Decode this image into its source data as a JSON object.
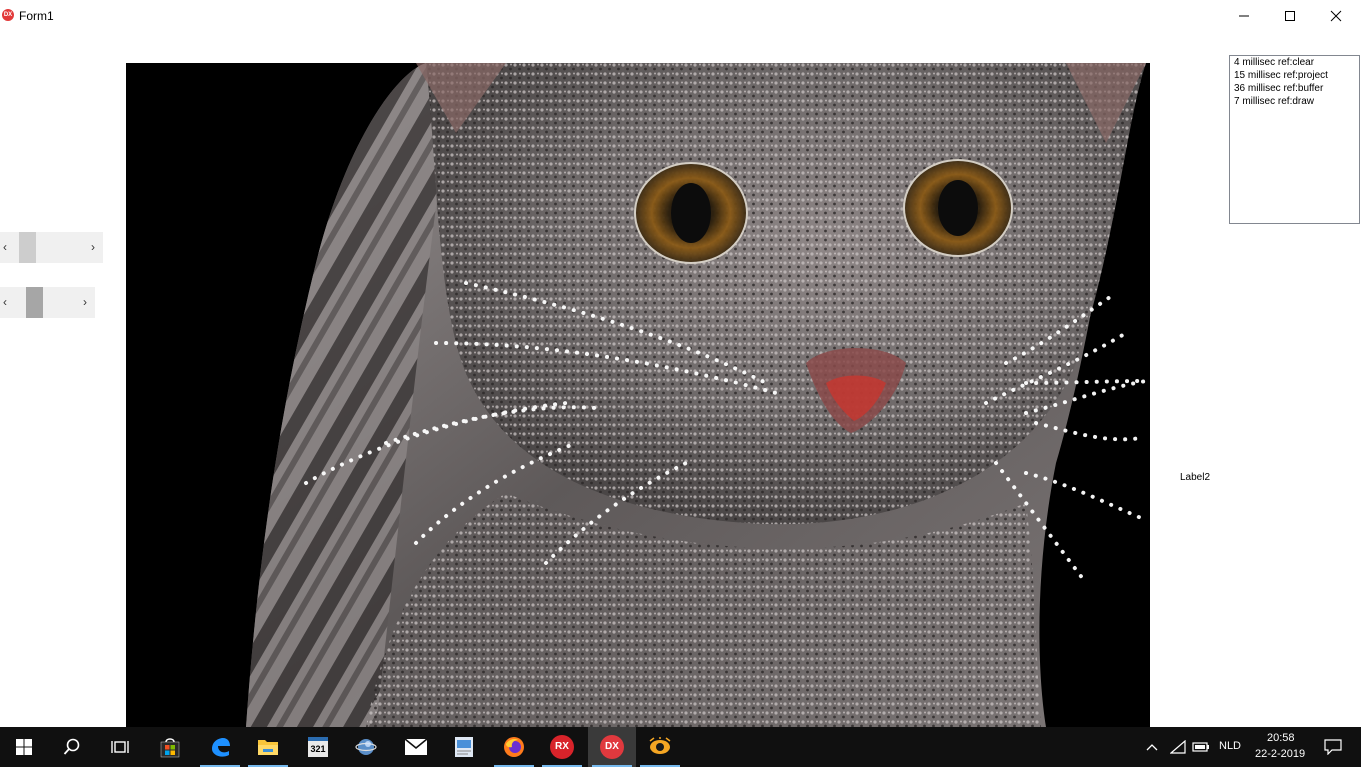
{
  "window": {
    "title": "Form1",
    "app_icon_text": "DX"
  },
  "memo": {
    "lines": [
      "4 millisec ref:clear",
      "15 millisec ref:project",
      "36 millisec ref:buffer",
      "7 millisec ref:draw"
    ]
  },
  "label2": "Label2",
  "scrollbars": [
    {
      "left_arrow": "‹",
      "right_arrow": "›",
      "position": 0.1
    },
    {
      "left_arrow": "‹",
      "right_arrow": "›",
      "position": 0.35
    }
  ],
  "taskbar": {
    "apps": [
      "start",
      "search",
      "task-view",
      "store",
      "edge",
      "file-explorer",
      "calendar-321",
      "maps",
      "mail",
      "photos",
      "firefox",
      "rx-app",
      "dx-app",
      "xnview"
    ],
    "rx_label": "RX",
    "dx_label": "DX",
    "calendar_label": "321",
    "language": "NLD",
    "time": "20:58",
    "date": "22-2-2019"
  },
  "colors": {
    "taskbar": "#101010",
    "accent": "#76b9ed",
    "canvas_bg": "#000000"
  }
}
